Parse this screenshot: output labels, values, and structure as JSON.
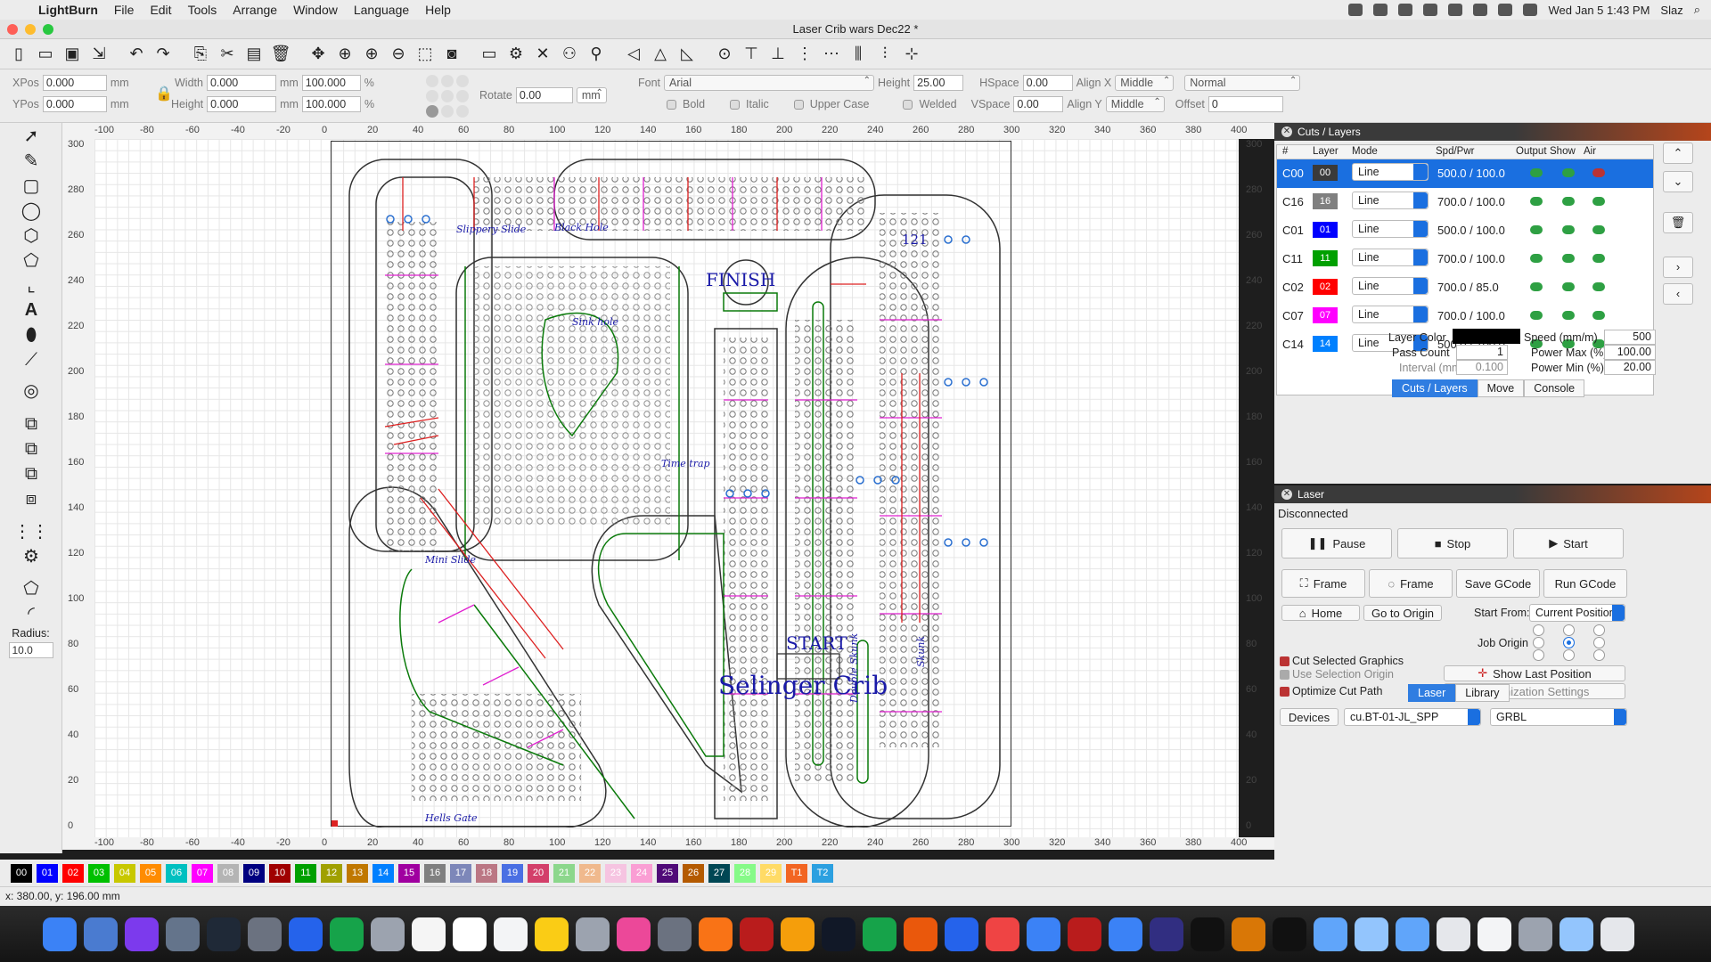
{
  "menubar": {
    "app": "LightBurn",
    "items": [
      "File",
      "Edit",
      "Tools",
      "Arrange",
      "Window",
      "Language",
      "Help"
    ],
    "clock": "Wed Jan 5  1:43 PM",
    "user": "Slaz"
  },
  "window": {
    "title": "Laser Crib wars Dec22 *"
  },
  "props": {
    "xpos_label": "XPos",
    "xpos": "0.000",
    "ypos_label": "YPos",
    "ypos": "0.000",
    "unit": "mm",
    "width_label": "Width",
    "width": "0.000",
    "height_label": "Height",
    "height": "0.000",
    "wpct": "100.000",
    "hpct": "100.000",
    "pct": "%",
    "rotate_label": "Rotate",
    "rotate": "0.00",
    "mm_btn": "mm",
    "font_label": "Font",
    "font": "Arial",
    "fheight_label": "Height",
    "fheight": "25.00",
    "hspace_label": "HSpace",
    "hspace": "0.00",
    "vspace_label": "VSpace",
    "vspace": "0.00",
    "alignx_label": "Align X",
    "alignx": "Middle",
    "aligny_label": "Align Y",
    "aligny": "Middle",
    "normal": "Normal",
    "offset_label": "Offset",
    "offset": "0",
    "bold": "Bold",
    "italic": "Italic",
    "upper": "Upper Case",
    "welded": "Welded"
  },
  "left": {
    "radius_label": "Radius:",
    "radius": "10.0"
  },
  "rulers": {
    "top": [
      "-100",
      "-80",
      "-60",
      "-40",
      "-20",
      "0",
      "20",
      "40",
      "60",
      "80",
      "100",
      "120",
      "140",
      "160",
      "180",
      "200",
      "220",
      "240",
      "260",
      "280",
      "300",
      "320",
      "340",
      "360",
      "380",
      "400"
    ],
    "left": [
      "300",
      "280",
      "260",
      "240",
      "220",
      "200",
      "180",
      "160",
      "140",
      "120",
      "100",
      "80",
      "60",
      "40",
      "20",
      "0"
    ]
  },
  "canvas_labels": {
    "slippery": "Slippery Slide",
    "blackhole": "Black Hole",
    "sinkhole": "Sink hole",
    "timetrap": "Time trap",
    "minislide": "Mini Slide",
    "hellsgate": "Hells Gate",
    "finish": "FINISH",
    "start": "START",
    "n121": "121",
    "doubleskunk": "Double Skunk",
    "skunk": "Skunk",
    "brand": "Selinger Crib"
  },
  "palette": [
    {
      "l": "00",
      "c": "#000000"
    },
    {
      "l": "01",
      "c": "#0000ff"
    },
    {
      "l": "02",
      "c": "#ff0000"
    },
    {
      "l": "03",
      "c": "#00c000"
    },
    {
      "l": "04",
      "c": "#c8c800"
    },
    {
      "l": "05",
      "c": "#ff8c00"
    },
    {
      "l": "06",
      "c": "#00c0c0"
    },
    {
      "l": "07",
      "c": "#ff00ff"
    },
    {
      "l": "08",
      "c": "#b4b4b4"
    },
    {
      "l": "09",
      "c": "#000080"
    },
    {
      "l": "10",
      "c": "#a00000"
    },
    {
      "l": "11",
      "c": "#00a000"
    },
    {
      "l": "12",
      "c": "#a0a000"
    },
    {
      "l": "13",
      "c": "#c07800"
    },
    {
      "l": "14",
      "c": "#0080ff"
    },
    {
      "l": "15",
      "c": "#a000a0"
    },
    {
      "l": "16",
      "c": "#808080"
    },
    {
      "l": "17",
      "c": "#7d87b9"
    },
    {
      "l": "18",
      "c": "#bb7784"
    },
    {
      "l": "19",
      "c": "#4a6fe3"
    },
    {
      "l": "20",
      "c": "#d33f6a"
    },
    {
      "l": "21",
      "c": "#8cd78c"
    },
    {
      "l": "22",
      "c": "#f0b98d"
    },
    {
      "l": "23",
      "c": "#f6c4e1"
    },
    {
      "l": "24",
      "c": "#fa9ed4"
    },
    {
      "l": "25",
      "c": "#500a78"
    },
    {
      "l": "26",
      "c": "#b45a00"
    },
    {
      "l": "27",
      "c": "#004754"
    },
    {
      "l": "28",
      "c": "#86fa88"
    },
    {
      "l": "29",
      "c": "#ffdb66"
    },
    {
      "l": "T1",
      "c": "#f26522"
    },
    {
      "l": "T2",
      "c": "#2ca0e0"
    }
  ],
  "status": "x: 380.00, y: 196.00 mm",
  "cuts": {
    "title": "Cuts / Layers",
    "headers": [
      "#",
      "Layer",
      "Mode",
      "Spd/Pwr",
      "Output",
      "Show",
      "Air"
    ],
    "rows": [
      {
        "id": "C00",
        "layer": "00",
        "color": "#3a3a3a",
        "mode": "Line",
        "sp": "500.0 / 100.0",
        "air": false
      },
      {
        "id": "C16",
        "layer": "16",
        "color": "#808080",
        "mode": "Line",
        "sp": "700.0 / 100.0",
        "air": true
      },
      {
        "id": "C01",
        "layer": "01",
        "color": "#0000ff",
        "mode": "Line",
        "sp": "500.0 / 100.0",
        "air": true
      },
      {
        "id": "C11",
        "layer": "11",
        "color": "#00a000",
        "mode": "Line",
        "sp": "700.0 / 100.0",
        "air": true
      },
      {
        "id": "C02",
        "layer": "02",
        "color": "#ff0000",
        "mode": "Line",
        "sp": "700.0 / 85.0",
        "air": true
      },
      {
        "id": "C07",
        "layer": "07",
        "color": "#ff00ff",
        "mode": "Line",
        "sp": "700.0 / 100.0",
        "air": true
      },
      {
        "id": "C14",
        "layer": "14",
        "color": "#0080ff",
        "mode": "Line",
        "sp": "500.0 / 100.0",
        "air": true
      }
    ],
    "layer_color_label": "Layer Color",
    "speed_label": "Speed (mm/m)",
    "speed": "500",
    "pass_label": "Pass Count",
    "pass": "1",
    "pmax_label": "Power Max (%)",
    "pmax": "100.00",
    "interval_label": "Interval (mm)",
    "interval": "0.100",
    "pmin_label": "Power Min (%)",
    "pmin": "20.00",
    "tabs": [
      "Cuts / Layers",
      "Move",
      "Console"
    ]
  },
  "laser": {
    "title": "Laser",
    "status": "Disconnected",
    "pause": "Pause",
    "stop": "Stop",
    "start": "Start",
    "frame1": "Frame",
    "frame2": "Frame",
    "save": "Save GCode",
    "run": "Run GCode",
    "home": "Home",
    "origin": "Go to Origin",
    "start_from_label": "Start From:",
    "start_from": "Current Position",
    "job_origin_label": "Job Origin",
    "cut_sel": "Cut Selected Graphics",
    "use_sel": "Use Selection Origin",
    "optimize": "Optimize Cut Path",
    "show_last": "Show Last Position",
    "opt_settings": "Optimization Settings",
    "devices": "Devices",
    "port": "cu.BT-01-JL_SPP",
    "firmware": "GRBL",
    "tabs": [
      "Laser",
      "Library"
    ]
  },
  "dock": [
    "Finder",
    "Launchpad",
    "Siri",
    "Rocket",
    "Activity",
    "Preview",
    "Safari",
    "FaceTime",
    "Automator",
    "Notes",
    "Calendar",
    "Reminders",
    "Stickies",
    "Preview",
    "Music",
    "Settings",
    "Books",
    "Photo Booth",
    "Photos",
    "Terminal",
    "Utorrent",
    "Firefox",
    "Books",
    "Chrome",
    "Messages",
    "Monosnap",
    "Messenger",
    "Amazon Music",
    "Spotify",
    "Archive",
    "UGS",
    "Preview",
    "Screenshot",
    "Folder",
    "Files",
    "Docs",
    "Settings",
    "Display",
    "Trash"
  ]
}
